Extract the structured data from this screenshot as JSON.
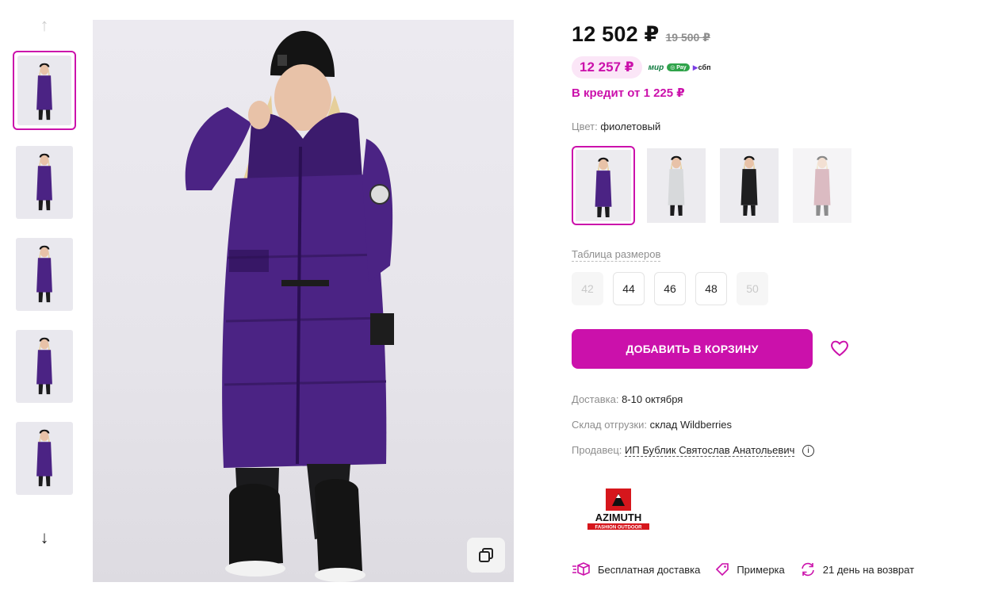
{
  "gallery": {
    "thumb_count": 5,
    "active_index": 0
  },
  "product": {
    "price": "12 502 ₽",
    "old_price": "19 500 ₽",
    "card_price": "12 257 ₽",
    "payment_icons": [
      "мир",
      "Pay",
      "сбп"
    ],
    "credit": "В кредит от 1 225 ₽",
    "color_label": "Цвет:",
    "color_value": "фиолетовый",
    "colors": [
      {
        "name": "фиолетовый",
        "coat": "#4b2384",
        "active": true
      },
      {
        "name": "светло-серый",
        "coat": "#d7d9db",
        "active": false
      },
      {
        "name": "черный",
        "coat": "#1f1f21",
        "active": false
      },
      {
        "name": "розовый",
        "coat": "#b97a86",
        "active": false,
        "faded": true
      }
    ],
    "size_table_label": "Таблица размеров",
    "sizes": [
      {
        "label": "42",
        "available": false
      },
      {
        "label": "44",
        "available": true
      },
      {
        "label": "46",
        "available": true
      },
      {
        "label": "48",
        "available": true
      },
      {
        "label": "50",
        "available": false
      }
    ],
    "cart_button": "ДОБАВИТЬ В КОРЗИНУ",
    "delivery_label": "Доставка:",
    "delivery_value": "8-10 октября",
    "warehouse_label": "Склад отгрузки:",
    "warehouse_value": "склад Wildberries",
    "seller_label": "Продавец:",
    "seller_value": "ИП Бублик Святослав Анатольевич",
    "brand_name": "AZIMUTH",
    "brand_tagline": "FASHION OUTDOOR"
  },
  "features": [
    {
      "icon": "box-delivery-icon",
      "label": "Бесплатная доставка"
    },
    {
      "icon": "tag-icon",
      "label": "Примерка"
    },
    {
      "icon": "return-icon",
      "label": "21 день на возврат"
    }
  ],
  "colors": {
    "accent": "#cb11ab",
    "coat_purple": "#4b2384"
  }
}
